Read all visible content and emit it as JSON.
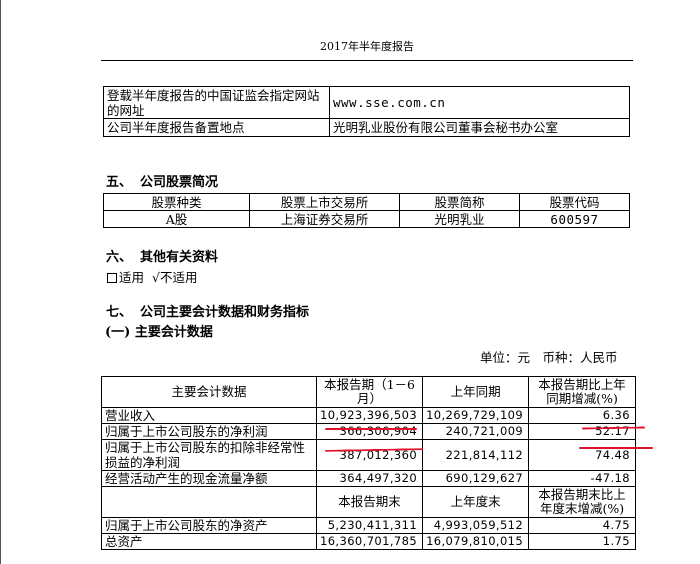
{
  "page_header": "2017年半年度报告",
  "info_table": [
    {
      "label": "登载半年度报告的中国证监会指定网站的网址",
      "value": "www.sse.com.cn"
    },
    {
      "label": "公司半年度报告备置地点",
      "value": "光明乳业股份有限公司董事会秘书办公室"
    }
  ],
  "section5": {
    "number": "五、",
    "title": "公司股票简况"
  },
  "stock_table": {
    "headers": [
      "股票种类",
      "股票上市交易所",
      "股票简称",
      "股票代码"
    ],
    "row": [
      "A股",
      "上海证券交易所",
      "光明乳业",
      "600597"
    ]
  },
  "section6": {
    "number": "六、",
    "title": "其他有关资料",
    "option_yes": "适用",
    "option_no": "√不适用"
  },
  "section7": {
    "number": "七、",
    "title": "公司主要会计数据和财务指标",
    "subtitle": "(一) 主要会计数据"
  },
  "unit_text": "单位：元　币种：人民币",
  "main_table": {
    "header1": {
      "col1": "主要会计数据",
      "col2": "本报告期（1－6月）",
      "col3": "上年同期",
      "col4": "本报告期比上年同期增减(%)"
    },
    "rows1": [
      {
        "label": "营业收入",
        "current": "10,923,396,503",
        "prior": "10,269,729,109",
        "change": "6.36"
      },
      {
        "label": "归属于上市公司股东的净利润",
        "current": "366,306,904",
        "prior": "240,721,009",
        "change": "52.17"
      },
      {
        "label": "归属于上市公司股东的扣除非经常性损益的净利润",
        "current": "387,012,360",
        "prior": "221,814,112",
        "change": "74.48"
      },
      {
        "label": "经营活动产生的现金流量净额",
        "current": "364,497,320",
        "prior": "690,129,627",
        "change": "-47.18"
      }
    ],
    "header2": {
      "col2": "本报告期末",
      "col3": "上年度末",
      "col4": "本报告期末比上年度末增减(%)"
    },
    "rows2": [
      {
        "label": "归属于上市公司股东的净资产",
        "current": "5,230,411,311",
        "prior": "4,993,059,512",
        "change": "4.75"
      },
      {
        "label": "总资产",
        "current": "16,360,701,785",
        "prior": "16,079,810,015",
        "change": "1.75"
      }
    ]
  },
  "annotation_color": "#e0122a"
}
